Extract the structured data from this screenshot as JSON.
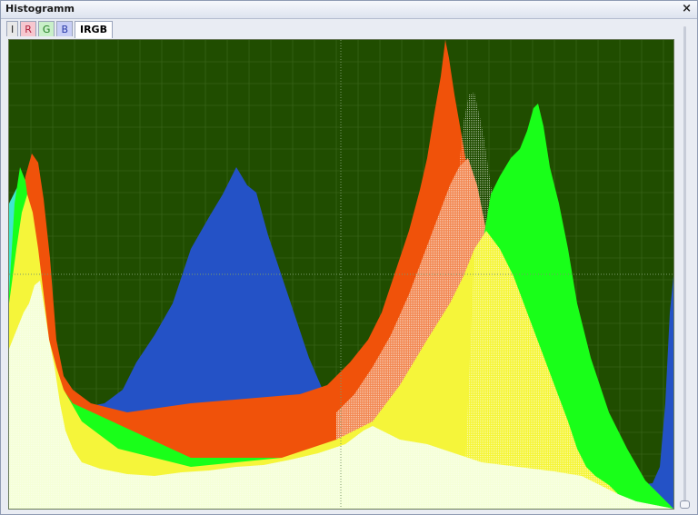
{
  "window": {
    "title": "Histogramm",
    "close_glyph": "×"
  },
  "tabs": [
    {
      "label": "I",
      "active": false
    },
    {
      "label": "R",
      "active": false
    },
    {
      "label": "G",
      "active": false
    },
    {
      "label": "B",
      "active": false
    },
    {
      "label": "IRGB",
      "active": true
    }
  ],
  "histogram": {
    "background": "#204d00",
    "grid_color": "#3f6a1f",
    "colors": {
      "blue": "#2452c6",
      "cyan": "#3fe6d0",
      "magenta": "#ee5bd0",
      "red": "#f0520a",
      "red_light": "#f28a55",
      "green": "#19ff19",
      "yellow": "#f5f53a",
      "white": "#f5ffd8"
    }
  },
  "slider": {
    "value": 1.0
  }
}
